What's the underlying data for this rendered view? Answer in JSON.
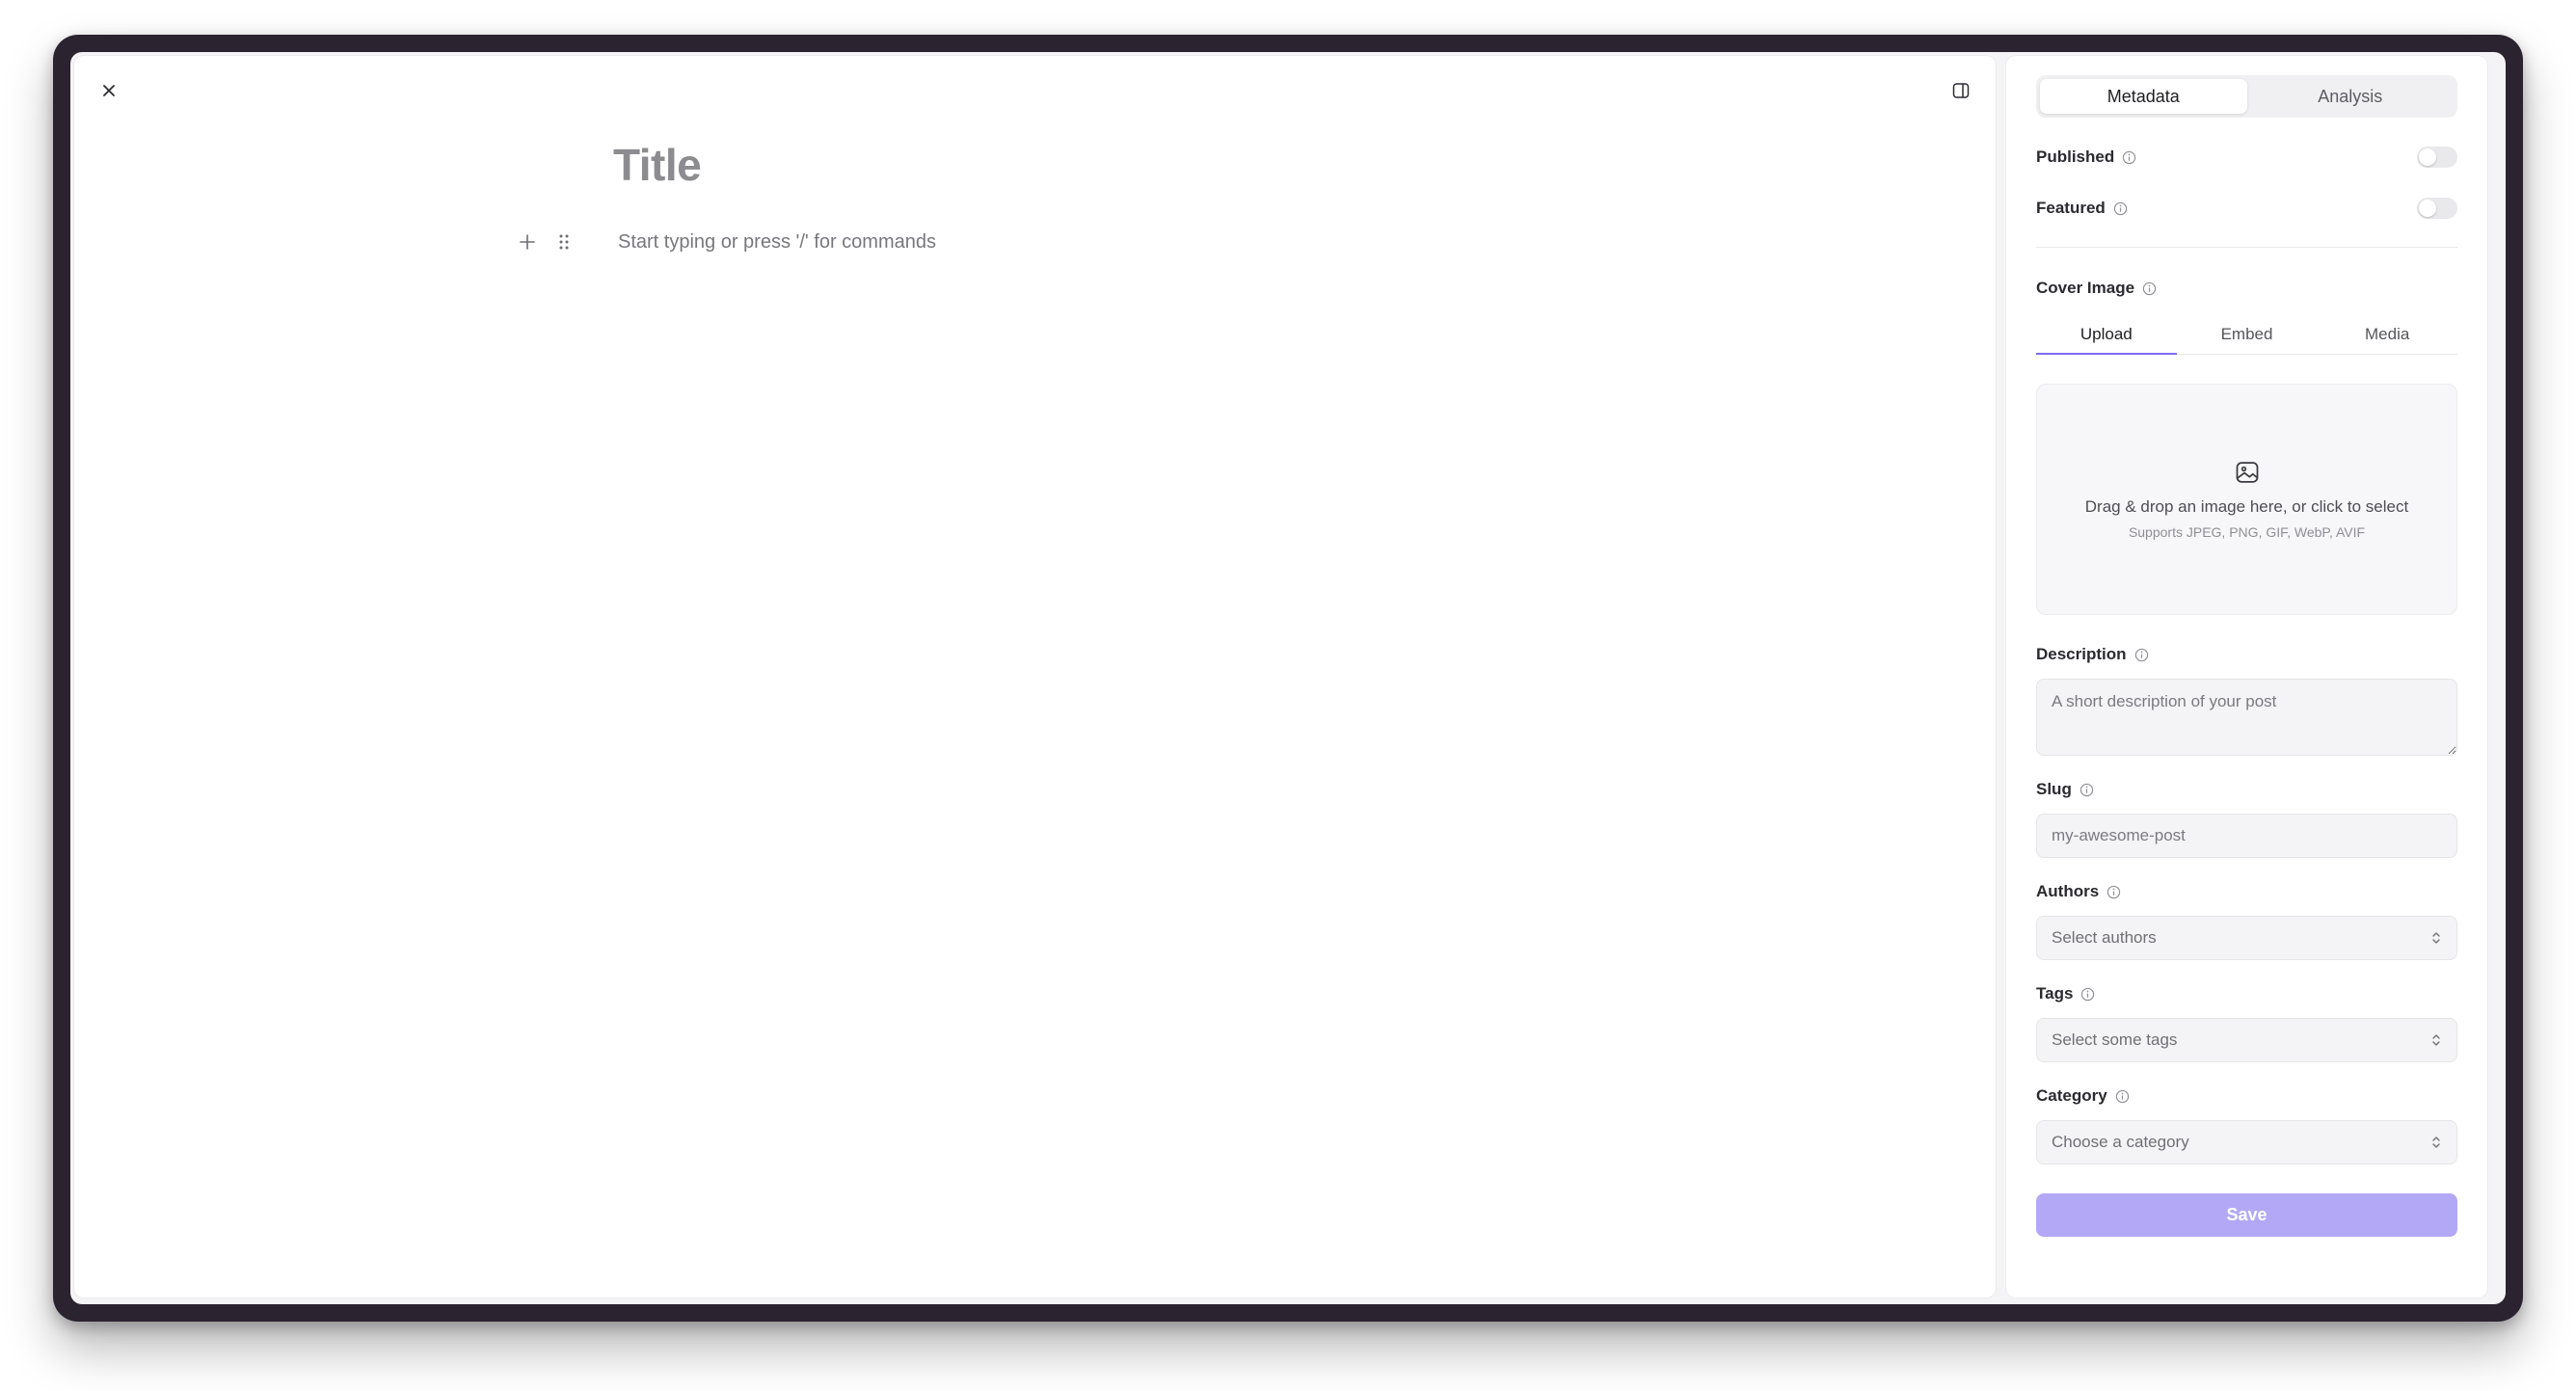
{
  "editor": {
    "title_placeholder": "Title",
    "body_placeholder": "Start typing or press '/' for commands"
  },
  "sidebar": {
    "tabs": [
      {
        "label": "Metadata",
        "active": true
      },
      {
        "label": "Analysis",
        "active": false
      }
    ],
    "published": {
      "label": "Published",
      "on": false
    },
    "featured": {
      "label": "Featured",
      "on": false
    },
    "cover_image": {
      "label": "Cover Image",
      "tabs": [
        {
          "label": "Upload",
          "active": true
        },
        {
          "label": "Embed",
          "active": false
        },
        {
          "label": "Media",
          "active": false
        }
      ],
      "dropzone_text": "Drag & drop an image here, or click to select",
      "dropzone_hint": "Supports JPEG, PNG, GIF, WebP, AVIF"
    },
    "description": {
      "label": "Description",
      "placeholder": "A short description of your post",
      "value": ""
    },
    "slug": {
      "label": "Slug",
      "placeholder": "my-awesome-post",
      "value": ""
    },
    "authors": {
      "label": "Authors",
      "placeholder": "Select authors"
    },
    "tags": {
      "label": "Tags",
      "placeholder": "Select some tags"
    },
    "category": {
      "label": "Category",
      "placeholder": "Choose a category"
    },
    "save_label": "Save"
  },
  "colors": {
    "accent": "#7c6cf0",
    "save_button": "#b3a8f6",
    "frame": "#2b2330"
  },
  "icons": [
    "close-icon",
    "panel-toggle-icon",
    "plus-icon",
    "drag-handle-icon",
    "info-icon",
    "image-icon",
    "chevron-updown-icon"
  ]
}
